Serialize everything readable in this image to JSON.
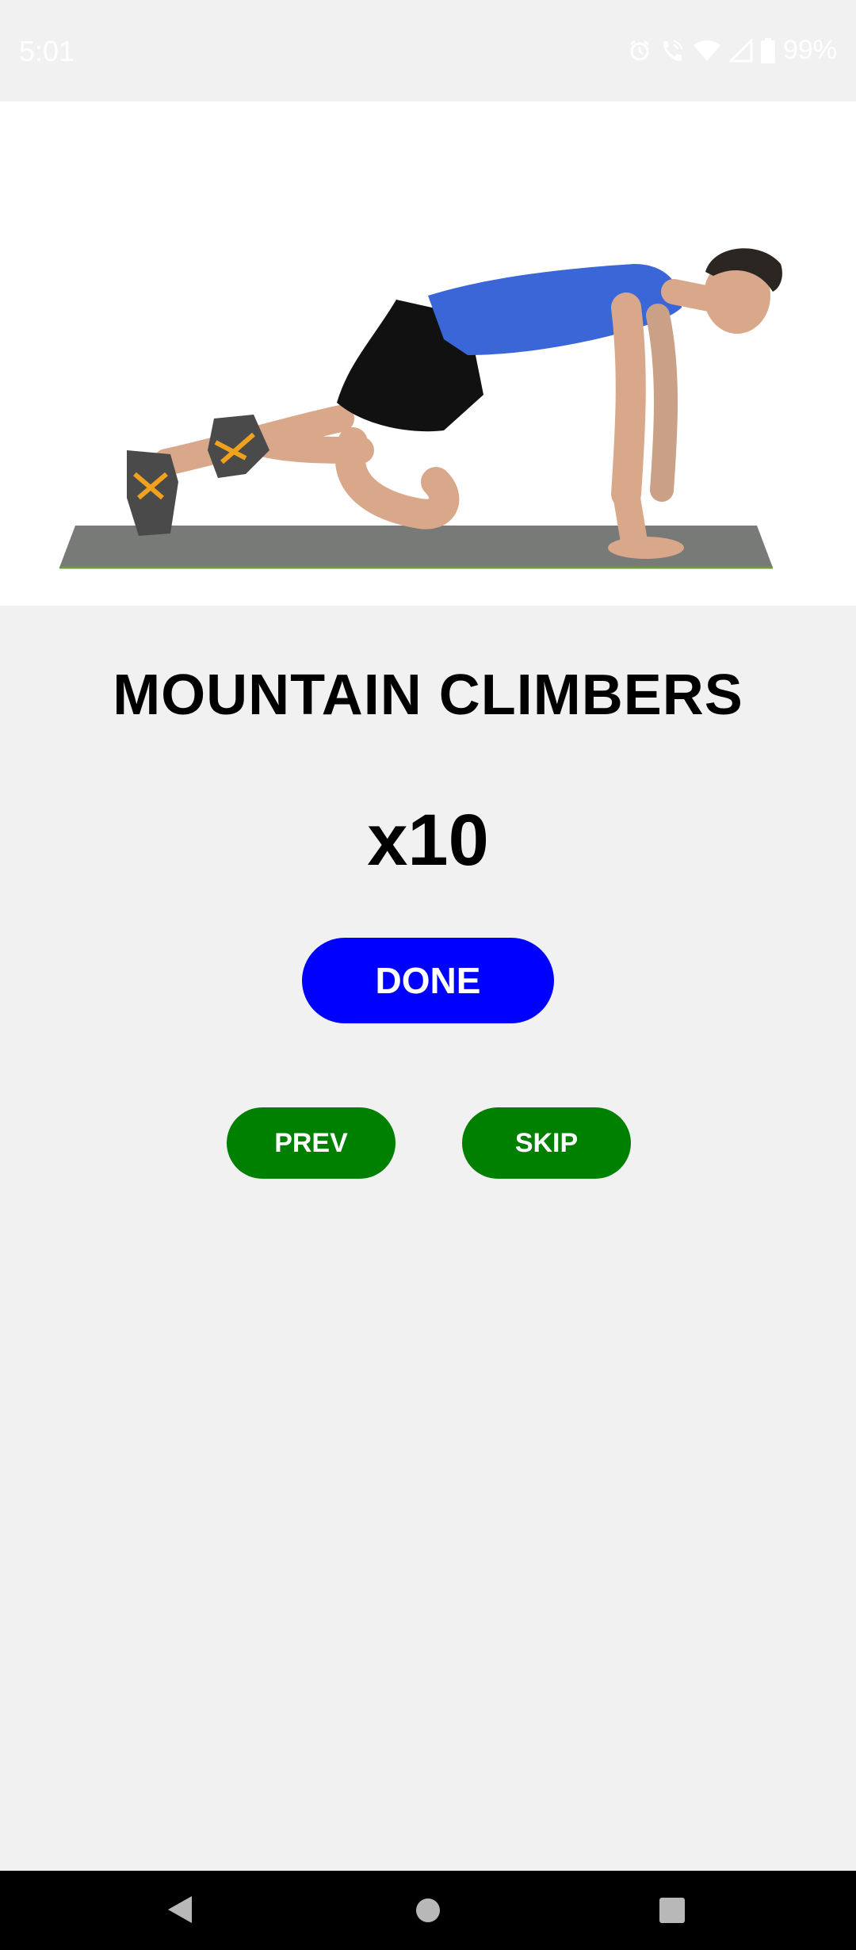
{
  "status_bar": {
    "time": "5:01",
    "battery": "99%",
    "icons": [
      "alarm-icon",
      "wifi-call-icon",
      "wifi-icon",
      "signal-icon",
      "battery-icon"
    ]
  },
  "exercise": {
    "image": "mountain-climbers-illustration",
    "title": "MOUNTAIN CLIMBERS",
    "reps": "x10"
  },
  "buttons": {
    "done_label": "DONE",
    "prev_label": "PREV",
    "skip_label": "SKIP"
  },
  "colors": {
    "background": "#f1f1f1",
    "done_button": "#0000ff",
    "nav_buttons": "#008000",
    "text": "#000000"
  },
  "system_nav": {
    "icons": [
      "back-icon",
      "home-icon",
      "recents-icon"
    ]
  }
}
